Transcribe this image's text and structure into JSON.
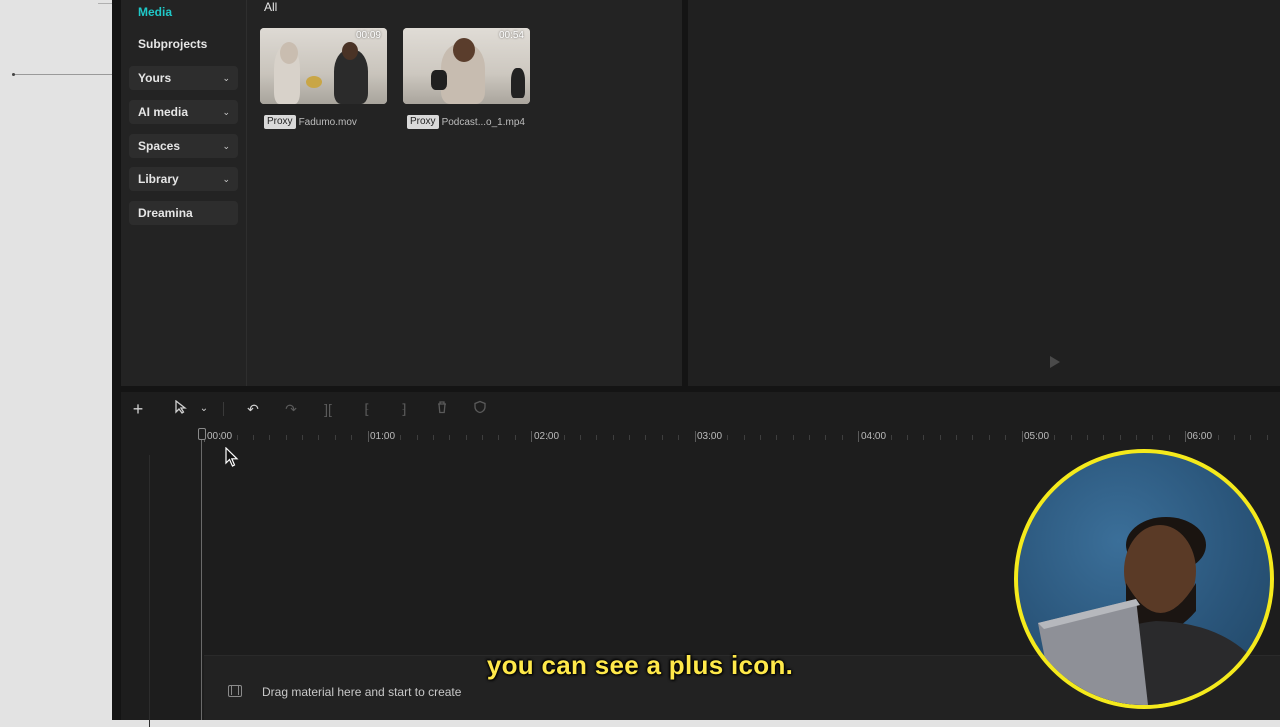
{
  "sidebar": {
    "items": [
      {
        "label": "Media",
        "active": true,
        "expandable": false
      },
      {
        "label": "Subprojects",
        "active": false,
        "expandable": false
      },
      {
        "label": "Yours",
        "active": false,
        "expandable": true
      },
      {
        "label": "AI media",
        "active": false,
        "expandable": true
      },
      {
        "label": "Spaces",
        "active": false,
        "expandable": true
      },
      {
        "label": "Library",
        "active": false,
        "expandable": true
      },
      {
        "label": "Dreamina",
        "active": false,
        "expandable": false
      }
    ],
    "accent_color": "#1fc8c8"
  },
  "media": {
    "filter": "All",
    "items": [
      {
        "proxy_label": "Proxy",
        "name": "Fadumo.mov",
        "duration": "00:09"
      },
      {
        "proxy_label": "Proxy",
        "name": "Podcast...o_1.mp4",
        "duration": "00:54"
      }
    ]
  },
  "timeline": {
    "ruler_labels": [
      "00:00",
      "01:00",
      "02:00",
      "03:00",
      "04:00",
      "05:00",
      "06:00"
    ],
    "drop_hint": "Drag material here and start to create",
    "tools": [
      "plus-icon",
      "select-pointer-icon",
      "chevron-down-icon",
      "undo-icon",
      "redo-icon",
      "split-icon",
      "trim-left-icon",
      "trim-right-icon",
      "delete-icon",
      "shield-icon"
    ]
  },
  "overlay": {
    "subtitle": "you can see a plus icon.",
    "subtitle_color": "#ffe94a",
    "webcam_border_color": "#f5ea1c"
  }
}
